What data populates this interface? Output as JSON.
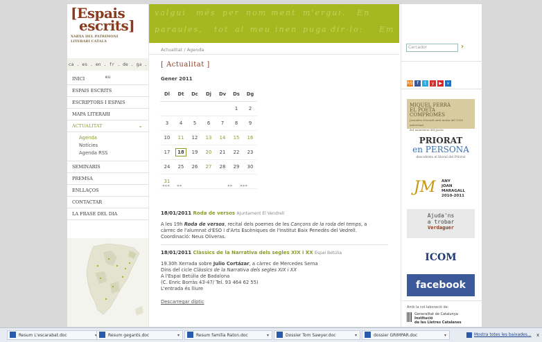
{
  "logo": {
    "line1": "[Espais",
    "line2": "escrits]",
    "sub1": "XARXA DEL PATRIMONI",
    "sub2": "LITERARI CATALÀ"
  },
  "langs": "ca . es . en . fr . de . ga . eu",
  "nav": {
    "items": [
      "INICI",
      "ESPAIS ESCRITS",
      "ESCRIPTORS I ESPAIS",
      "MAPA LITERARI",
      "ACTUALITAT"
    ],
    "sub": [
      "Agenda",
      "Notícies",
      "Agenda RSS"
    ],
    "items2": [
      "SEMINARIS",
      "PREMSA",
      "ENLLAÇOS",
      "CONTACTAR",
      "LA FRASE DEL DIA"
    ]
  },
  "banner_words": [
    "valgui",
    "més",
    "per",
    "nom",
    "ment",
    "m'ergui.",
    "En",
    "paraules,",
    "tot",
    "al",
    "meu",
    "inen",
    "puga",
    "dir-lo:",
    "Em"
  ],
  "breadcrumb": "Actualitat / Agenda",
  "section_title": "[ Actualitat ]",
  "calendar": {
    "month": "Gener 2011",
    "days": [
      "Dl",
      "Dt",
      "Dc",
      "Dj",
      "Dv",
      "Ds",
      "Dg"
    ],
    "weeks": [
      [
        "",
        "",
        "",
        "",
        "",
        "1",
        "2"
      ],
      [
        "3",
        "4",
        "5",
        "6",
        "7",
        "8",
        "9"
      ],
      [
        "10",
        "11",
        "12",
        "13",
        "14",
        "15",
        "16"
      ],
      [
        "17",
        "18",
        "19",
        "20",
        "21",
        "22",
        "23"
      ],
      [
        "24",
        "25",
        "26",
        "27",
        "28",
        "29",
        "30"
      ],
      [
        "31",
        "",
        "",
        "",
        "",
        "",
        ""
      ]
    ],
    "highlight": [
      "11",
      "13",
      "14",
      "15",
      "16",
      "20",
      "27",
      "31"
    ],
    "today": "18",
    "nav": {
      "first": "«««",
      "prev": "««",
      "next": "»»",
      "last": "»»»"
    }
  },
  "events": [
    {
      "date": "18/01/2011",
      "title": "Roda de versos",
      "place": "Ajuntament El Vendrell",
      "body1_pre": "A les 19h ",
      "body1_em": "Roda de versos",
      "body1_mid": ", recital dels poemes de les ",
      "body1_em2": "Cançons de la roda del temps",
      "body1_post": ", a",
      "body2": "càrrec de l'alumnat d'ESO i d'Arts Escèniques de l'Institut Baix Penedès del Vedrell.",
      "body3": "Coordinació: Neus Oliveras."
    },
    {
      "date": "18/01/2011",
      "title": "Clàssics de la Narrativa dels segles XIX i XX",
      "place": "Espai Betúlia",
      "l1_pre": "19.30h Xerrada sobre ",
      "l1_b": "Julio Cortázar",
      "l1_post": ", a càrrec de Mercedes Serna",
      "l2_pre": "Dins del cicle ",
      "l2_em": "Clàssics de la Narrativa dels segles XIX i XX",
      "l3": "A l'Espai Betúlia de Badalona",
      "l4": "(C. Enric Borràs 43-47/ Tel. 93 464 62 55)",
      "l5": "L'entrada és lliure",
      "link": "Descarregar díptic"
    }
  ],
  "search": {
    "placeholder": "Cercador",
    "go": "›"
  },
  "social": [
    "RSS",
    "f",
    "t",
    "y",
    "▶",
    "v"
  ],
  "social_colors": [
    "#f0801a",
    "#3b5998",
    "#2aa9e0",
    "#c33",
    "#d22",
    "#1e6fbf"
  ],
  "promos": {
    "terra": {
      "l1": "MIQUEL FERRÀ",
      "l2": "EL POETA COMPROMÈS",
      "l3": "Jornades d'estudi amb motiu del 125è aniversari",
      "l4": "del naixement del poeta"
    },
    "priorat": {
      "a": "PRIORAT",
      "b": "en PERSONA",
      "c": "descobreix el litoral del Priorat"
    },
    "maragall": {
      "m": "JM",
      "t1": "ANY",
      "t2": "JOAN",
      "t3": "MARAGALL",
      "t4": "2010-2011"
    },
    "verdaguer": {
      "a1": "Ajuda'ns",
      "a2": "a trobar",
      "b": "Verdaguer"
    },
    "icom": "ICOM",
    "facebook": "facebook"
  },
  "collab": "Amb la col·laboració de:",
  "gencat": {
    "l1": "Generalitat de Catalunya",
    "l2": "Institució",
    "l3": "de les Lletres Catalanes"
  },
  "taskbar": {
    "items": [
      "Resum L'escarabat.doc",
      "Resum gegants.doc",
      "Resum família Raton.doc",
      "Dossier Tom Sawyer.doc",
      "dossier GRIMPAR.doc"
    ],
    "show_all": "Mostra totes les baixades...",
    "close": "x"
  }
}
